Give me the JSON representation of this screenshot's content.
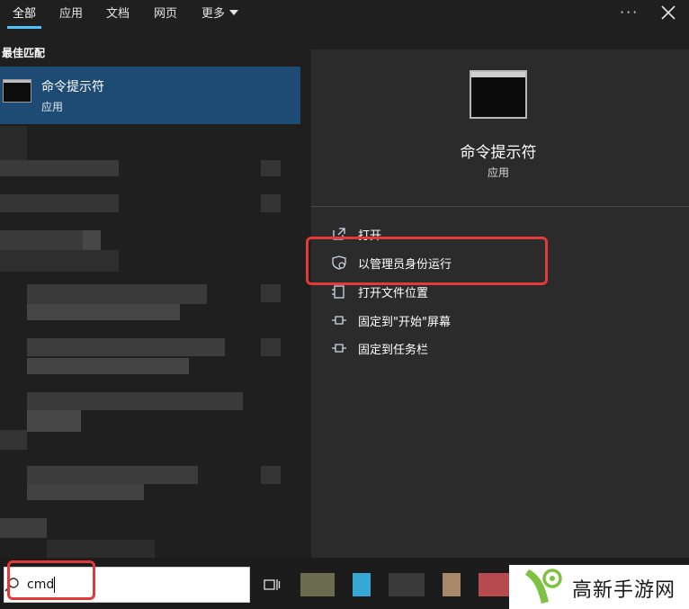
{
  "tabs": [
    {
      "label": "全部",
      "active": true
    },
    {
      "label": "应用",
      "active": false
    },
    {
      "label": "文档",
      "active": false
    },
    {
      "label": "网页",
      "active": false
    },
    {
      "label": "更多",
      "active": false,
      "has_dropdown": true
    }
  ],
  "top_right": {
    "more_options": "···"
  },
  "left_panel": {
    "section_title": "最佳匹配",
    "best_match": {
      "name": "命令提示符",
      "type": "应用",
      "icon": "cmd-terminal-icon"
    }
  },
  "detail": {
    "name": "命令提示符",
    "type": "应用",
    "icon": "cmd-terminal-icon",
    "actions": [
      {
        "label": "打开",
        "icon": "open-icon"
      },
      {
        "label": "以管理员身份运行",
        "icon": "shield-admin-icon",
        "highlighted": true
      },
      {
        "label": "打开文件位置",
        "icon": "folder-location-icon"
      },
      {
        "label": "固定到\"开始\"屏幕",
        "icon": "pin-start-icon"
      },
      {
        "label": "固定到任务栏",
        "icon": "pin-taskbar-icon"
      }
    ]
  },
  "taskbar": {
    "search_value": "cmd",
    "search_icon": "search-icon",
    "task_view_icon": "task-view-icon"
  },
  "watermark": {
    "text": "高新手游网"
  },
  "colors": {
    "background": "#1f1f1f",
    "selected_item": "#1d4b73",
    "detail_panel": "#2b2b2b",
    "accent": "#4cc2ff",
    "highlight_box": "#e23a3a"
  }
}
